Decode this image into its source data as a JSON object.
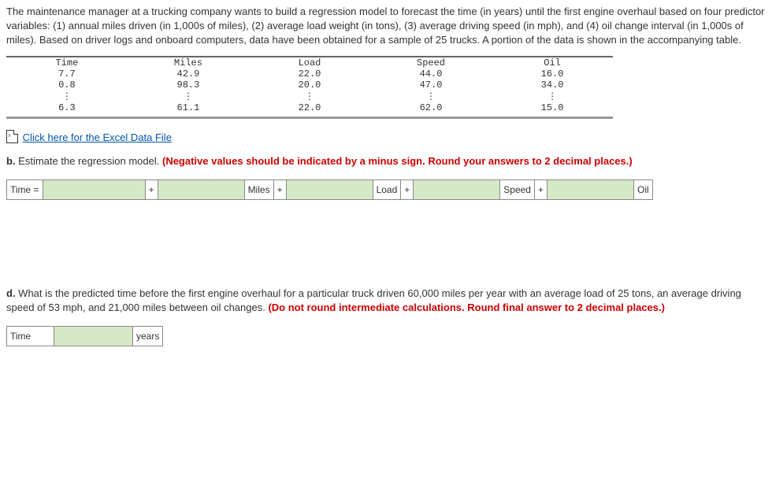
{
  "intro": "The maintenance manager at a trucking company wants to build a regression model to forecast the time (in years) until the first engine overhaul based on four predictor variables: (1) annual miles driven (in 1,000s of miles), (2) average load weight (in tons), (3) average driving speed (in mph), and (4) oil change interval (in 1,000s of miles). Based on driver logs and onboard computers, data have been obtained for a sample of 25 trucks. A portion of the data is shown in the accompanying table.",
  "table": {
    "headers": {
      "c1": "Time",
      "c2": "Miles",
      "c3": "Load",
      "c4": "Speed",
      "c5": "Oil"
    },
    "row1": {
      "c1": "7.7",
      "c2": "42.9",
      "c3": "22.0",
      "c4": "44.0",
      "c5": "16.0"
    },
    "row2": {
      "c1": "0.8",
      "c2": "98.3",
      "c3": "20.0",
      "c4": "47.0",
      "c5": "34.0"
    },
    "row3": {
      "c1": "⋮",
      "c2": "⋮",
      "c3": "⋮",
      "c4": "⋮",
      "c5": "⋮"
    },
    "row4": {
      "c1": "6.3",
      "c2": "61.1",
      "c3": "22.0",
      "c4": "62.0",
      "c5": "15.0"
    }
  },
  "link_text": " Click here for the Excel Data File",
  "part_b": {
    "prefix": "b.",
    "plain": " Estimate the regression model. ",
    "red": "(Negative values should be indicated by a minus sign. Round your answers to 2 decimal places.)"
  },
  "eq": {
    "lhs": "Time =",
    "plus": "+",
    "v1": "Miles",
    "v2": "Load",
    "v3": "Speed",
    "v4": "Oil"
  },
  "part_d": {
    "prefix": "d.",
    "plain": " What is the predicted time before the first engine overhaul for a particular truck driven 60,000 miles per year with an average load of 25 tons, an average driving speed of 53 mph, and 21,000 miles between oil changes. ",
    "red": "(Do not round intermediate calculations. Round final answer to 2 decimal places.)"
  },
  "time_row": {
    "label": "Time",
    "unit": "years"
  }
}
